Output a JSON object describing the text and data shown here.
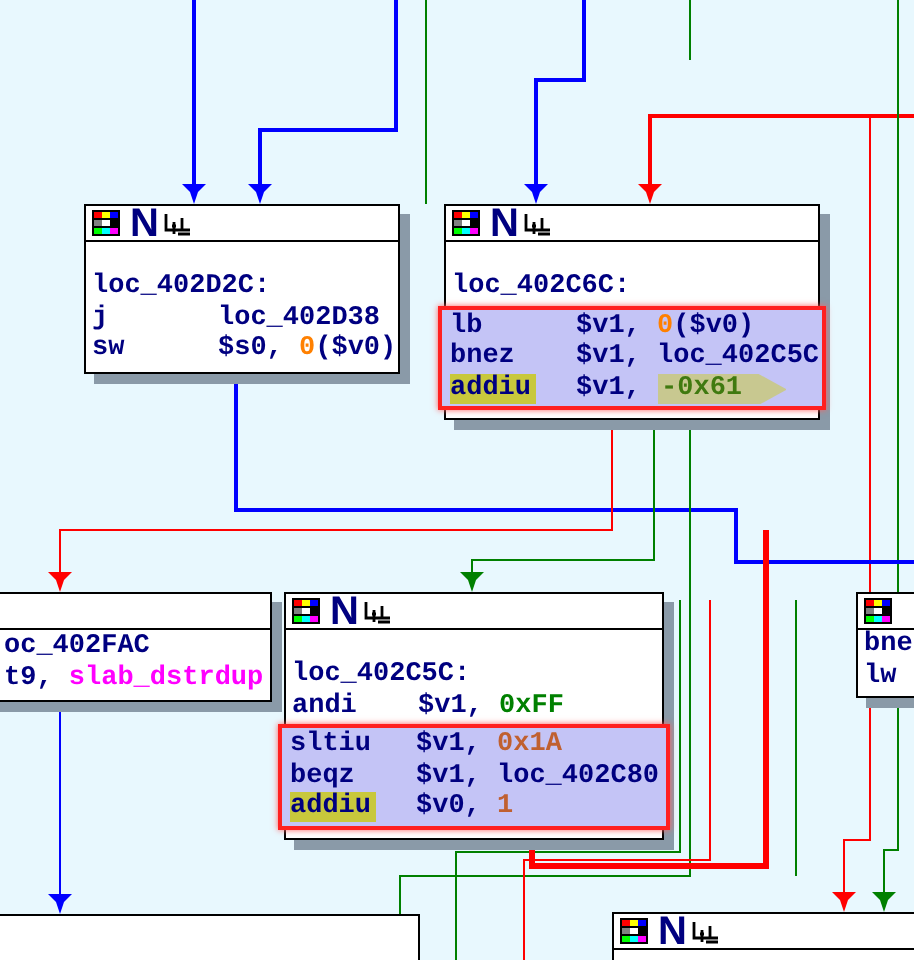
{
  "nodes": [
    {
      "kind": "full",
      "letter": "N",
      "lines": [
        {
          "kind": "label",
          "text": "loc_402D2C:"
        },
        {
          "kind": "insn",
          "mnemonic": "j",
          "marked": false,
          "selected": false,
          "operands": [
            {
              "text": "loc_402D38"
            }
          ]
        },
        {
          "kind": "insn",
          "mnemonic": "sw",
          "marked": false,
          "selected": false,
          "operands": [
            {
              "text": "$s0, "
            },
            {
              "text": "0",
              "color": "#ff8000"
            },
            {
              "text": "($v0)"
            }
          ]
        }
      ]
    },
    {
      "kind": "full",
      "letter": "N",
      "lines": [
        {
          "kind": "label",
          "text": "loc_402C6C:"
        },
        {
          "kind": "insn",
          "mnemonic": "lb",
          "marked": false,
          "selected": true,
          "operands": [
            {
              "text": "$v1, "
            },
            {
              "text": "0",
              "color": "#ff8000"
            },
            {
              "text": "($v0)"
            }
          ]
        },
        {
          "kind": "insn",
          "mnemonic": "bnez",
          "marked": false,
          "selected": true,
          "operands": [
            {
              "text": "$v1, loc_402C5C"
            }
          ]
        },
        {
          "kind": "insn",
          "mnemonic": "addiu",
          "marked": true,
          "selected": true,
          "operands": [
            {
              "text": "$v1, "
            },
            {
              "text": "-0x61",
              "tagged": true
            }
          ]
        }
      ]
    },
    {
      "kind": "partial",
      "lines": [
        {
          "kind": "text",
          "operands": [
            {
              "text": "oc_402FAC"
            }
          ]
        },
        {
          "kind": "text",
          "operands": [
            {
              "text": "t9, "
            },
            {
              "text": "slab_dstrdup",
              "color": "#ff00ff"
            }
          ]
        }
      ]
    },
    {
      "kind": "full",
      "letter": "N",
      "lines": [
        {
          "kind": "label",
          "text": "loc_402C5C:"
        },
        {
          "kind": "insn",
          "mnemonic": "andi",
          "marked": false,
          "selected": false,
          "operands": [
            {
              "text": "$v1, "
            },
            {
              "text": "0xFF",
              "color": "#008000"
            }
          ]
        },
        {
          "kind": "insn",
          "mnemonic": "sltiu",
          "marked": false,
          "selected": true,
          "operands": [
            {
              "text": "$v1, "
            },
            {
              "text": "0x1A",
              "color": "#c06030"
            }
          ]
        },
        {
          "kind": "insn",
          "mnemonic": "beqz",
          "marked": false,
          "selected": true,
          "operands": [
            {
              "text": "$v1, loc_402C80"
            }
          ]
        },
        {
          "kind": "insn",
          "mnemonic": "addiu",
          "marked": true,
          "selected": true,
          "operands": [
            {
              "text": "$v0, "
            },
            {
              "text": "1",
              "color": "#c06030"
            }
          ]
        }
      ]
    },
    {
      "kind": "header_cut",
      "lines": [
        {
          "kind": "text",
          "operands": [
            {
              "text": "bne"
            }
          ]
        },
        {
          "kind": "text",
          "operands": [
            {
              "text": "lw"
            }
          ]
        }
      ]
    },
    {
      "kind": "header_only",
      "letter": "N"
    }
  ]
}
